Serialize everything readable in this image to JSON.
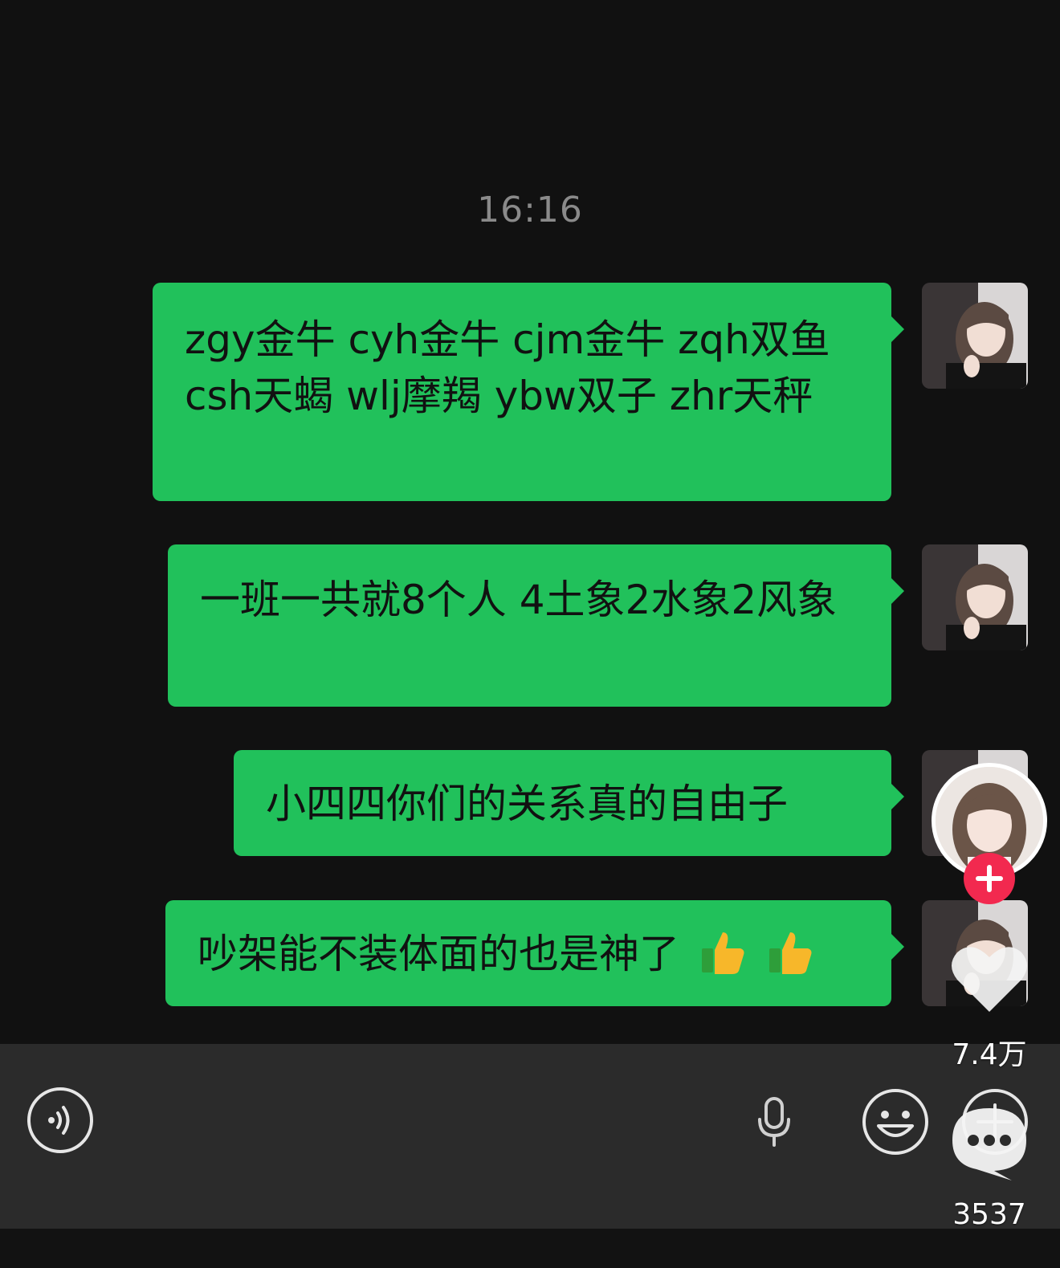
{
  "chat": {
    "timestamp": "16:16",
    "messages": [
      {
        "text": "zgy金牛 cyh金牛 cjm金牛 zqh双鱼 csh天蝎 wlj摩羯 ybw双子 zhr天秤"
      },
      {
        "text": "一班一共就8个人 4土象2水象2风象"
      },
      {
        "text": "小四四你们的关系真的自由子"
      },
      {
        "text": "吵架能不装体面的也是神了",
        "emoji": [
          "thumbs-up",
          "thumbs-up"
        ]
      }
    ]
  },
  "input_bar": {
    "icons": [
      "voice-icon",
      "microphone-icon",
      "emoji-icon",
      "plus-icon"
    ]
  },
  "overlay": {
    "like_count": "7.4万",
    "comment_count": "3537",
    "colors": {
      "bubble": "#21c15b",
      "follow_plus": "#f2294f"
    }
  }
}
